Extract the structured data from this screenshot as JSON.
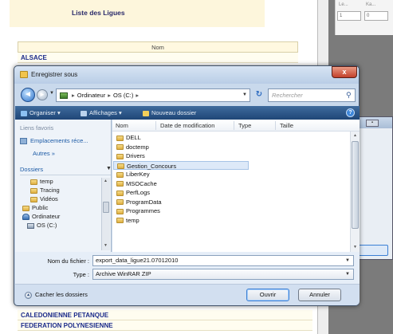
{
  "background_page": {
    "title": "Liste des Ligues",
    "column_header": "Nom",
    "top_rows": [
      "ALSACE"
    ],
    "bottom_rows": [
      "CALEDONIENNE PETANQUE",
      "FEDERATION POLYNESIENNE"
    ]
  },
  "right_panel": {
    "label_1": "Le...",
    "label_2": "Ka...",
    "box_1": "1",
    "box_2": "0"
  },
  "dialog": {
    "title": "Enregistrer sous",
    "close_label": "x",
    "address": {
      "segments": [
        "Ordinateur",
        "OS (C:)"
      ],
      "separator": "▸"
    },
    "search": {
      "placeholder": "Rechercher"
    },
    "toolbar": {
      "organize": "Organiser",
      "views": "Affichages",
      "new_folder": "Nouveau dossier"
    },
    "nav_pane": {
      "favorites_header": "Liens favoris",
      "favorite_item": "Emplacements réce...",
      "more": "Autres",
      "more_chevron": "»",
      "folders_header": "Dossiers",
      "tree": [
        {
          "label": "temp",
          "icon": "folder-icon"
        },
        {
          "label": "Tracing",
          "icon": "folder-icon"
        },
        {
          "label": "Vidéos",
          "icon": "folder-icon"
        },
        {
          "label": "Public",
          "icon": "user-folder-icon"
        },
        {
          "label": "Ordinateur",
          "icon": "computer-icon"
        },
        {
          "label": "OS (C:)",
          "icon": "drive-icon"
        }
      ]
    },
    "columns": {
      "name": "Nom",
      "modified": "Date de modification",
      "type": "Type",
      "size": "Taille"
    },
    "files": [
      "DELL",
      "doctemp",
      "Drivers",
      "Gestion_Concours",
      "LiberKey",
      "MSOCache",
      "PerfLogs",
      "ProgramData",
      "Programmes",
      "temp"
    ],
    "selected_file_index": 3,
    "filename_label": "Nom du fichier :",
    "filename_value": "export_data_ligue21.07012010",
    "filetype_label": "Type :",
    "filetype_value": "Archive WinRAR ZIP",
    "hide_folders": "Cacher les dossiers",
    "open_button": "Ouvrir",
    "cancel_button": "Annuler"
  }
}
